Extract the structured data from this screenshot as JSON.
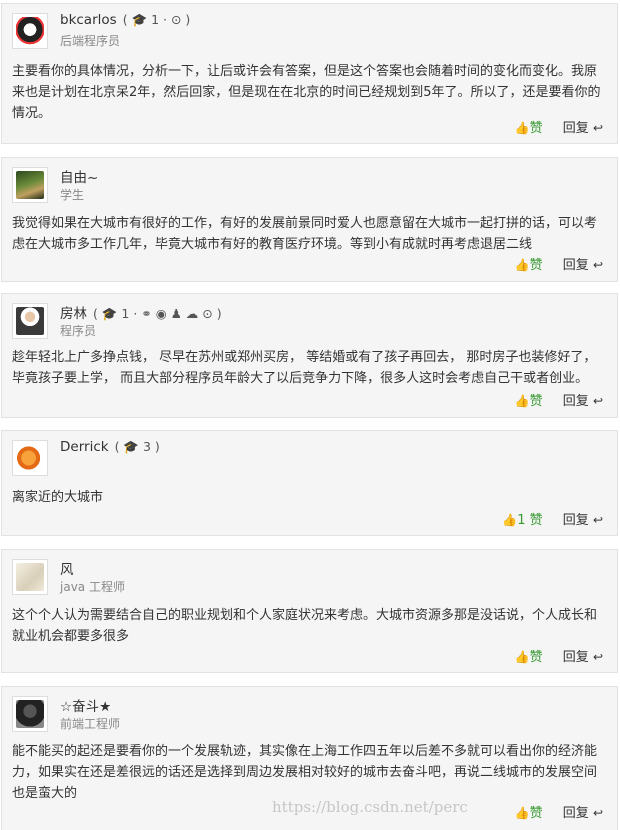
{
  "comments": [
    {
      "name": "bkcarlos",
      "meta": "( 🎓 1 · ⊙ )",
      "title": "后端程序员",
      "content": "主要看你的具体情况，分析一下，让后或许会有答案，但是这个答案也会随着时间的变化而变化。我原来也是计划在北京呆2年，然后回家，但是现在在北京的时间已经规划到5年了。所以了，还是要看你的情况。",
      "like_label": "赞",
      "reply_label": "回复"
    },
    {
      "name": "自由~",
      "meta": "",
      "title": "学生",
      "content": "我觉得如果在大城市有很好的工作，有好的发展前景同时爱人也愿意留在大城市一起打拼的话，可以考虑在大城市多工作几年，毕竟大城市有好的教育医疗环境。等到小有成就时再考虑退居二线",
      "like_label": "赞",
      "reply_label": "回复"
    },
    {
      "name": "房林",
      "meta": "( 🎓 1 · ⚭ ◉ ♟ ☁ ⊙ )",
      "title": "程序员",
      "content": "趁年轻北上广多挣点钱， 尽早在苏州或郑州买房， 等结婚或有了孩子再回去， 那时房子也装修好了，毕竟孩子要上学， 而且大部分程序员年龄大了以后竞争力下降，很多人这时会考虑自己干或者创业。",
      "like_label": "赞",
      "reply_label": "回复"
    },
    {
      "name": "Derrick",
      "meta": "( 🎓 3 )",
      "title": "",
      "content": "离家近的大城市",
      "like_label": "1 赞",
      "reply_label": "回复"
    },
    {
      "name": "风",
      "meta": "",
      "title": "java 工程师",
      "content": "这个个人认为需要结合自己的职业规划和个人家庭状况来考虑。大城市资源多那是没话说，个人成长和就业机会都要多很多",
      "like_label": "赞",
      "reply_label": "回复"
    },
    {
      "name": "☆奋斗★",
      "meta": "",
      "title": "前端工程师",
      "content": "能不能买的起还是要看你的一个发展轨迹，其实像在上海工作四五年以后差不多就可以看出你的经济能力，如果实在还是差很远的话还是选择到周边发展相对较好的城市去奋斗吧，再说二线城市的发展空间也是蛮大的",
      "like_label": "赞",
      "reply_label": "回复"
    }
  ],
  "watermark": "https://blog.csdn.net/perc",
  "icons": {
    "like": "thumbs-up-icon",
    "reply": "reply-arrow-icon"
  },
  "colors": {
    "like": "#3a9b35",
    "card_bg": "#f5f5f5",
    "border": "#e2e2e2"
  }
}
